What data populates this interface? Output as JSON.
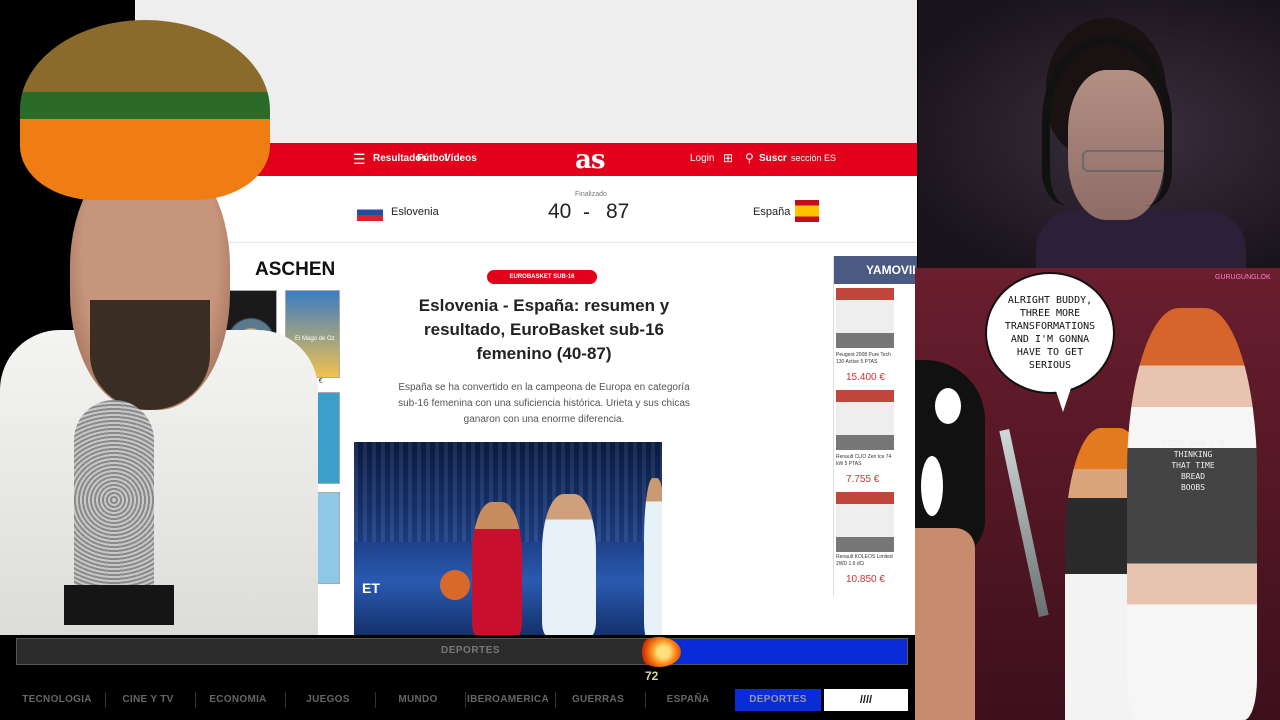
{
  "as_site": {
    "nav": {
      "links": [
        "Resultados",
        "Fútbol",
        "Vídeos"
      ],
      "logo": "as",
      "login": "Login",
      "subscribe": "Suscr",
      "region": "sección ES"
    },
    "match": {
      "home_team": "Eslovenia",
      "away_team": "España",
      "status": "Finalizado",
      "home_score": "40",
      "away_score": "87",
      "separator": "-"
    },
    "ad_left": {
      "title": "ASCHEN",
      "corner": "i ×",
      "book_label": "El Mago de Oz",
      "price": "18 €"
    },
    "article": {
      "tag": "EUROBASKET SUB-16",
      "headline": "Eslovenia - España: resumen y resultado, EuroBasket sub-16 femenino (40-87)",
      "summary": "España se ha convertido en la campeona de Europa en categoría sub-16 femenina con una suficiencia histórica. Urieta y sus chicas ganaron con una enorme diferencia.",
      "photo_text": "ET"
    },
    "ad_right": {
      "brand": "YAMOVIL",
      "cars": [
        {
          "desc": "Peugeot 2008 Pure Tech 130 Active 5 PTAS",
          "price": "15.400 €"
        },
        {
          "desc": "Renault CLIO Zen tce 74 kW 5 PTAS",
          "price": "7.755 €"
        },
        {
          "desc": "Renault KOLEOS Limited 2WD 1.6 dCi",
          "price": "10.850 €"
        }
      ]
    }
  },
  "comic": {
    "credit": "GURUGUNGLOK",
    "bubble": "ALRIGHT BUDDY,\nTHREE MORE\nTRANSFORMATIONS\nAND I'M GONNA\nHAVE TO GET\nSERIOUS",
    "shirt": "RIGHT NOW I'M\nTHINKING\nTHAT TIME\nBREAD\nBOOBS"
  },
  "ticker": {
    "bar_label": "DEPORTES",
    "count": "72",
    "categories": [
      "TECNOLOGIA",
      "CINE Y TV",
      "ECONOMIA",
      "JUEGOS",
      "MUNDO",
      "IBEROAMERICA",
      "GUERRAS",
      "ESPAÑA",
      "DEPORTES"
    ],
    "box_label": "////"
  },
  "colors": {
    "as_red": "#e2001a",
    "ticker_blue": "#0a2bd8"
  }
}
